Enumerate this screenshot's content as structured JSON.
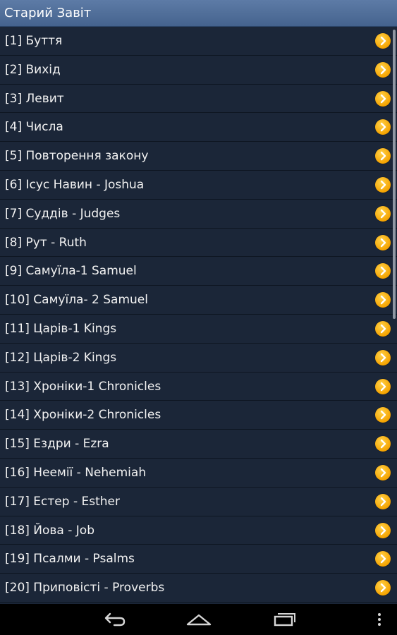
{
  "header": {
    "title": "Старий Завіт"
  },
  "books": [
    {
      "label": "[1] Буття"
    },
    {
      "label": "[2] Вихід"
    },
    {
      "label": "[3] Левит"
    },
    {
      "label": "[4] Числа"
    },
    {
      "label": "[5] Повторення закону"
    },
    {
      "label": "[6] Ісус Навин - Joshua"
    },
    {
      "label": "[7] Суддів - Judges"
    },
    {
      "label": "[8] Рут - Ruth"
    },
    {
      "label": "[9] Самуїла-1 Samuel"
    },
    {
      "label": "[10] Самуїла- 2 Samuel"
    },
    {
      "label": "[11] Царів-1 Kings"
    },
    {
      "label": "[12] Царів-2 Kings"
    },
    {
      "label": "[13] Хроніки-1 Chronicles"
    },
    {
      "label": "[14] Хроніки-2 Chronicles"
    },
    {
      "label": "[15] Ездри - Ezra"
    },
    {
      "label": "[16] Неемії - Nehemiah"
    },
    {
      "label": "[17] Естер - Esther"
    },
    {
      "label": "[18] Йова - Job"
    },
    {
      "label": "[19] Псалми - Psalms"
    },
    {
      "label": "[20] Приповісті - Proverbs"
    }
  ],
  "icons": {
    "row_arrow": "chevron-right-circle-icon",
    "nav_back": "back-arrow-icon",
    "nav_home": "home-icon",
    "nav_recent": "recent-apps-icon",
    "nav_menu": "overflow-menu-icon"
  },
  "colors": {
    "title_bar": "#4f6d98",
    "list_background": "#1b2638",
    "row_text": "#f2f2f2",
    "arrow_icon": "#f5a300"
  }
}
